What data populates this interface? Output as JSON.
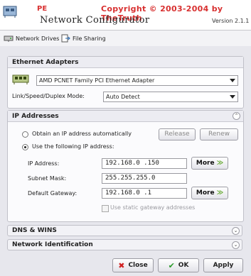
{
  "header": {
    "pe_label": "PE",
    "copyright": "Copyright © 2003-2004 by TheTruth",
    "title": "Network Configurator",
    "version": "Version 2.1.1"
  },
  "toolbar": {
    "network_drives": "Network Drives",
    "file_sharing": "File Sharing"
  },
  "ethernet": {
    "heading": "Ethernet Adapters",
    "adapter": "AMD PCNET Family PCI Ethernet Adapter",
    "link_label": "Link/Speed/Duplex Mode:",
    "link_value": "Auto Detect"
  },
  "ip": {
    "heading": "IP Addresses",
    "auto_label": "Obtain an IP address automatically",
    "release": "Release",
    "renew": "Renew",
    "manual_label": "Use the following IP address:",
    "ip_label": "IP Address:",
    "ip_value": "192.168.0 .150",
    "mask_label": "Subnet Mask:",
    "mask_value": "255.255.255.0",
    "gateway_label": "Default Gateway:",
    "gateway_value": "192.168.0 .1",
    "more": "More",
    "static_gw_label": "Use static gateway addresses"
  },
  "sections": {
    "dns": "DNS & WINS",
    "netid": "Network Identification"
  },
  "footer": {
    "close": "Close",
    "ok": "OK",
    "apply": "Apply"
  }
}
